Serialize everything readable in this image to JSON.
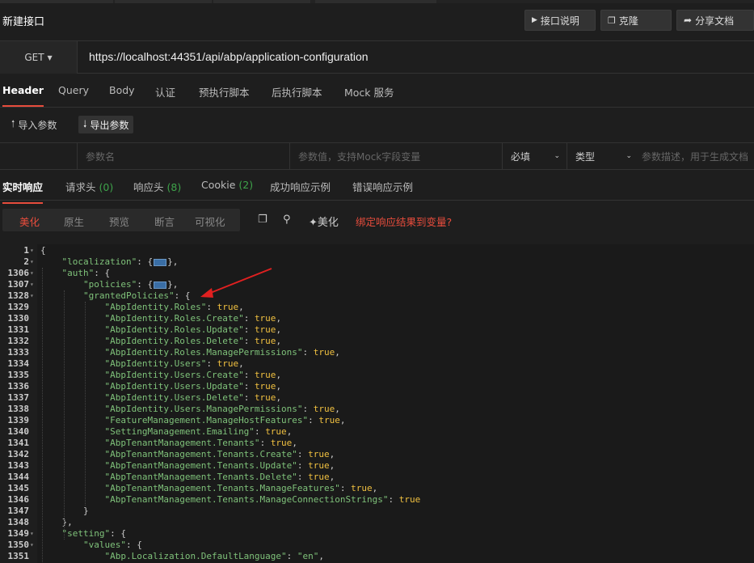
{
  "window": {
    "title": "新建接口"
  },
  "toolbar": {
    "doc_label": "接口说明",
    "clone_label": "克隆",
    "share_label": "分享文档",
    "doc_icon": "play-icon",
    "clone_icon": "copy-icon",
    "share_icon": "share-icon"
  },
  "request": {
    "method": "GET",
    "url": "https://localhost:44351/api/abp/application-configuration"
  },
  "request_tabs": [
    "Header",
    "Query",
    "Body",
    "认证",
    "预执行脚本",
    "后执行脚本",
    "Mock 服务"
  ],
  "params": {
    "import_label": "导入参数",
    "export_label": "导出参数",
    "name_placeholder": "参数名",
    "value_placeholder": "参数值，支持Mock字段变量",
    "required_label": "必填",
    "type_label": "类型",
    "desc_placeholder": "参数描述，用于生成文档"
  },
  "response_tabs": [
    {
      "label": "实时响应",
      "count": ""
    },
    {
      "label": "请求头",
      "count": "(0)"
    },
    {
      "label": "响应头",
      "count": "(8)"
    },
    {
      "label": "Cookie",
      "count": "(2)"
    },
    {
      "label": "成功响应示例",
      "count": ""
    },
    {
      "label": "错误响应示例",
      "count": ""
    }
  ],
  "view_modes": [
    "美化",
    "原生",
    "预览",
    "断言",
    "可视化"
  ],
  "view_tools": {
    "beautify_label": "美化",
    "bind_link": "绑定响应结果到变量?"
  },
  "editor_lines": [
    {
      "n": "1",
      "fold": true,
      "indent": 0,
      "parts": [
        [
          "p",
          "{"
        ]
      ]
    },
    {
      "n": "2",
      "fold": true,
      "indent": 1,
      "parts": [
        [
          "s",
          "\"localization\""
        ],
        [
          "p",
          ": {"
        ],
        [
          "c",
          ""
        ],
        [
          "p",
          "},"
        ]
      ]
    },
    {
      "n": "1306",
      "fold": true,
      "indent": 1,
      "parts": [
        [
          "s",
          "\"auth\""
        ],
        [
          "p",
          ": {"
        ]
      ]
    },
    {
      "n": "1307",
      "fold": true,
      "indent": 2,
      "parts": [
        [
          "s",
          "\"policies\""
        ],
        [
          "p",
          ": {"
        ],
        [
          "c",
          ""
        ],
        [
          "p",
          "},"
        ]
      ]
    },
    {
      "n": "1328",
      "fold": true,
      "indent": 2,
      "parts": [
        [
          "s",
          "\"grantedPolicies\""
        ],
        [
          "p",
          ": {"
        ]
      ]
    },
    {
      "n": "1329",
      "indent": 3,
      "parts": [
        [
          "s",
          "\"AbpIdentity.Roles\""
        ],
        [
          "p",
          ": "
        ],
        [
          "b",
          "true"
        ],
        [
          "p",
          ","
        ]
      ]
    },
    {
      "n": "1330",
      "indent": 3,
      "parts": [
        [
          "s",
          "\"AbpIdentity.Roles.Create\""
        ],
        [
          "p",
          ": "
        ],
        [
          "b",
          "true"
        ],
        [
          "p",
          ","
        ]
      ]
    },
    {
      "n": "1331",
      "indent": 3,
      "parts": [
        [
          "s",
          "\"AbpIdentity.Roles.Update\""
        ],
        [
          "p",
          ": "
        ],
        [
          "b",
          "true"
        ],
        [
          "p",
          ","
        ]
      ]
    },
    {
      "n": "1332",
      "indent": 3,
      "parts": [
        [
          "s",
          "\"AbpIdentity.Roles.Delete\""
        ],
        [
          "p",
          ": "
        ],
        [
          "b",
          "true"
        ],
        [
          "p",
          ","
        ]
      ]
    },
    {
      "n": "1333",
      "indent": 3,
      "parts": [
        [
          "s",
          "\"AbpIdentity.Roles.ManagePermissions\""
        ],
        [
          "p",
          ": "
        ],
        [
          "b",
          "true"
        ],
        [
          "p",
          ","
        ]
      ]
    },
    {
      "n": "1334",
      "indent": 3,
      "parts": [
        [
          "s",
          "\"AbpIdentity.Users\""
        ],
        [
          "p",
          ": "
        ],
        [
          "b",
          "true"
        ],
        [
          "p",
          ","
        ]
      ]
    },
    {
      "n": "1335",
      "indent": 3,
      "parts": [
        [
          "s",
          "\"AbpIdentity.Users.Create\""
        ],
        [
          "p",
          ": "
        ],
        [
          "b",
          "true"
        ],
        [
          "p",
          ","
        ]
      ]
    },
    {
      "n": "1336",
      "indent": 3,
      "parts": [
        [
          "s",
          "\"AbpIdentity.Users.Update\""
        ],
        [
          "p",
          ": "
        ],
        [
          "b",
          "true"
        ],
        [
          "p",
          ","
        ]
      ]
    },
    {
      "n": "1337",
      "indent": 3,
      "parts": [
        [
          "s",
          "\"AbpIdentity.Users.Delete\""
        ],
        [
          "p",
          ": "
        ],
        [
          "b",
          "true"
        ],
        [
          "p",
          ","
        ]
      ]
    },
    {
      "n": "1338",
      "indent": 3,
      "parts": [
        [
          "s",
          "\"AbpIdentity.Users.ManagePermissions\""
        ],
        [
          "p",
          ": "
        ],
        [
          "b",
          "true"
        ],
        [
          "p",
          ","
        ]
      ]
    },
    {
      "n": "1339",
      "indent": 3,
      "parts": [
        [
          "s",
          "\"FeatureManagement.ManageHostFeatures\""
        ],
        [
          "p",
          ": "
        ],
        [
          "b",
          "true"
        ],
        [
          "p",
          ","
        ]
      ]
    },
    {
      "n": "1340",
      "indent": 3,
      "parts": [
        [
          "s",
          "\"SettingManagement.Emailing\""
        ],
        [
          "p",
          ": "
        ],
        [
          "b",
          "true"
        ],
        [
          "p",
          ","
        ]
      ]
    },
    {
      "n": "1341",
      "indent": 3,
      "parts": [
        [
          "s",
          "\"AbpTenantManagement.Tenants\""
        ],
        [
          "p",
          ": "
        ],
        [
          "b",
          "true"
        ],
        [
          "p",
          ","
        ]
      ]
    },
    {
      "n": "1342",
      "indent": 3,
      "parts": [
        [
          "s",
          "\"AbpTenantManagement.Tenants.Create\""
        ],
        [
          "p",
          ": "
        ],
        [
          "b",
          "true"
        ],
        [
          "p",
          ","
        ]
      ]
    },
    {
      "n": "1343",
      "indent": 3,
      "parts": [
        [
          "s",
          "\"AbpTenantManagement.Tenants.Update\""
        ],
        [
          "p",
          ": "
        ],
        [
          "b",
          "true"
        ],
        [
          "p",
          ","
        ]
      ]
    },
    {
      "n": "1344",
      "indent": 3,
      "parts": [
        [
          "s",
          "\"AbpTenantManagement.Tenants.Delete\""
        ],
        [
          "p",
          ": "
        ],
        [
          "b",
          "true"
        ],
        [
          "p",
          ","
        ]
      ]
    },
    {
      "n": "1345",
      "indent": 3,
      "parts": [
        [
          "s",
          "\"AbpTenantManagement.Tenants.ManageFeatures\""
        ],
        [
          "p",
          ": "
        ],
        [
          "b",
          "true"
        ],
        [
          "p",
          ","
        ]
      ]
    },
    {
      "n": "1346",
      "indent": 3,
      "parts": [
        [
          "s",
          "\"AbpTenantManagement.Tenants.ManageConnectionStrings\""
        ],
        [
          "p",
          ": "
        ],
        [
          "b",
          "true"
        ]
      ]
    },
    {
      "n": "1347",
      "indent": 2,
      "parts": [
        [
          "p",
          "}"
        ]
      ]
    },
    {
      "n": "1348",
      "indent": 1,
      "parts": [
        [
          "p",
          "},"
        ]
      ]
    },
    {
      "n": "1349",
      "fold": true,
      "indent": 1,
      "parts": [
        [
          "s",
          "\"setting\""
        ],
        [
          "p",
          ": {"
        ]
      ]
    },
    {
      "n": "1350",
      "fold": true,
      "indent": 2,
      "parts": [
        [
          "s",
          "\"values\""
        ],
        [
          "p",
          ": {"
        ]
      ]
    },
    {
      "n": "1351",
      "indent": 3,
      "parts": [
        [
          "s",
          "\"Abp.Localization.DefaultLanguage\""
        ],
        [
          "p",
          ": "
        ],
        [
          "s",
          "\"en\""
        ],
        [
          "p",
          ","
        ]
      ]
    }
  ],
  "colors": {
    "accent": "#e74c3c",
    "string": "#7fc27a",
    "boolean": "#f0c040",
    "count": "#3ea34a"
  }
}
